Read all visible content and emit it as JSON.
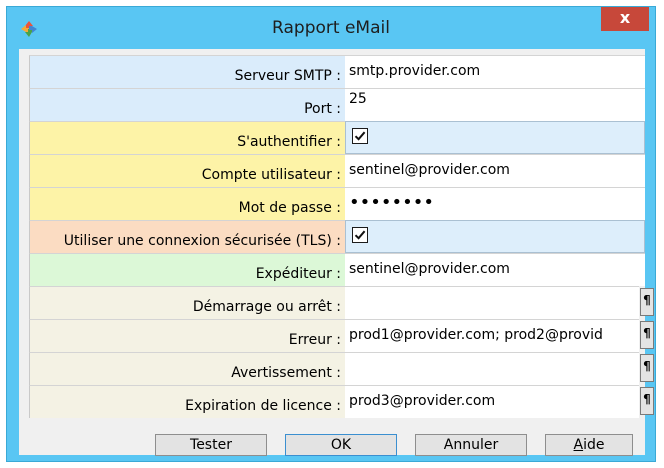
{
  "window": {
    "title": "Rapport eMail",
    "close_glyph": "x"
  },
  "fields": [
    {
      "label": "Serveur SMTP :",
      "value": "smtp.provider.com",
      "color": "#daecfb"
    },
    {
      "label": "Port :",
      "value": "25",
      "color": "#daecfb"
    },
    {
      "label": "S'authentifier :",
      "checked": true,
      "color": "#fdf3a7"
    },
    {
      "label": "Compte utilisateur :",
      "value": "sentinel@provider.com",
      "color": "#fdf3a7"
    },
    {
      "label": "Mot de passe :",
      "value": "••••••••",
      "color": "#fdf3a7"
    },
    {
      "label": "Utiliser une connexion sécurisée (TLS) :",
      "checked": true,
      "color": "#fbdcc2"
    },
    {
      "label": "Expéditeur :",
      "value": "sentinel@provider.com",
      "color": "#dcf8d7"
    },
    {
      "label": "Démarrage ou arrêt :",
      "value": "",
      "color": "#f4f2e4"
    },
    {
      "label": "Erreur :",
      "value": "prod1@provider.com; prod2@provid",
      "color": "#f4f2e4"
    },
    {
      "label": "Avertissement :",
      "value": "",
      "color": "#f4f2e4"
    },
    {
      "label": "Expiration de licence :",
      "value": "prod3@provider.com",
      "color": "#f4f2e4"
    }
  ],
  "pilcrow_glyph": "¶",
  "buttons": {
    "tester": "Tester",
    "ok": "OK",
    "annuler": "Annuler",
    "aide_first": "A",
    "aide_rest": "ide"
  }
}
